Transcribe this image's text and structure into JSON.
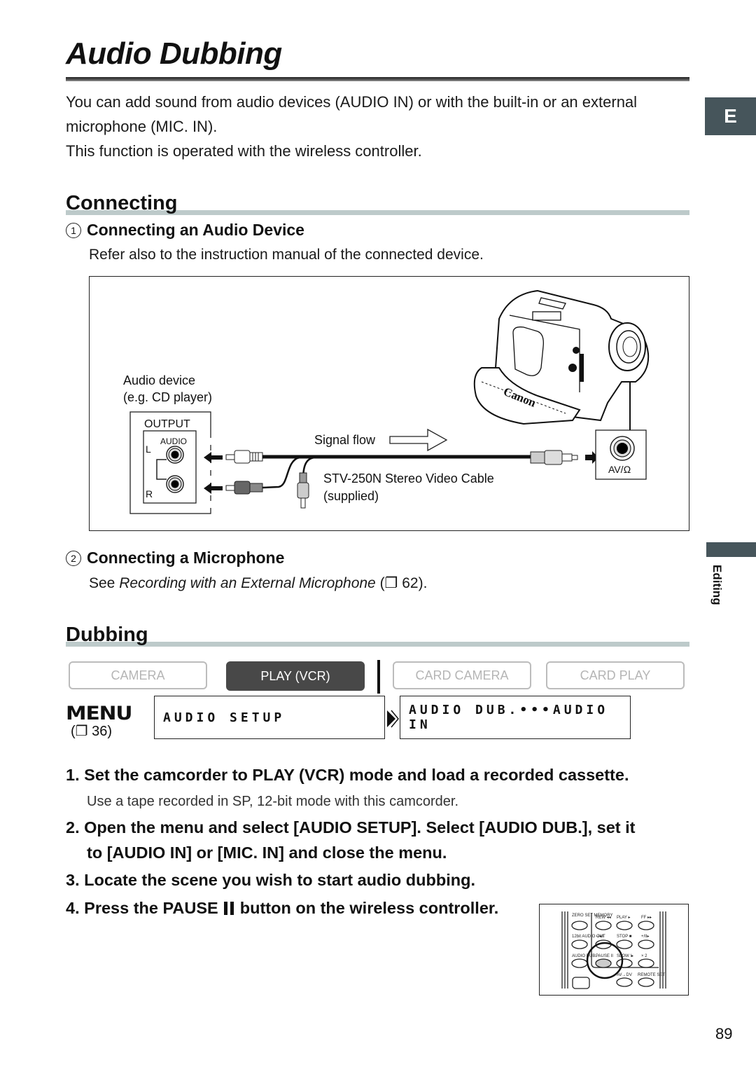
{
  "page": {
    "title": "Audio Dubbing",
    "language_tab": "E",
    "chapter_tab": "Editing",
    "page_number": "89"
  },
  "intro": {
    "line1": "You can add sound from audio devices (AUDIO IN) or with the built-in or an external",
    "line2": "microphone (MIC. IN).",
    "line3": "This function is operated with the wireless controller."
  },
  "connecting": {
    "heading": "Connecting",
    "audio_device": {
      "number": "1",
      "heading": "Connecting an Audio Device",
      "text": "Refer also to the instruction manual of the connected device."
    },
    "diagram": {
      "audio_device_label_1": "Audio device",
      "audio_device_label_2": "(e.g. CD player)",
      "output_label": "OUTPUT",
      "audio_label": "AUDIO",
      "left_label": "L",
      "right_label": "R",
      "signal_flow_label": "Signal flow",
      "cable_label_1": "STV-250N Stereo Video Cable",
      "cable_label_2": "(supplied)",
      "camcorder_jack_label": "AV/Ω",
      "brand_label": "Canon"
    },
    "microphone": {
      "number": "2",
      "heading": "Connecting a Microphone",
      "text_prefix": "See ",
      "text_ref": "Recording with an External Microphone",
      "text_suffix": " (❐ 62)."
    }
  },
  "dubbing": {
    "heading": "Dubbing",
    "modes": [
      {
        "label": "CAMERA",
        "active": false
      },
      {
        "label": "PLAY (VCR)",
        "active": true
      },
      {
        "label": "CARD CAMERA",
        "active": false
      },
      {
        "label": "CARD PLAY",
        "active": false
      }
    ],
    "menu": {
      "logo": "MENU",
      "ref": "(❐ 36)",
      "item1": "AUDIO SETUP",
      "item2": "AUDIO DUB.•••AUDIO IN"
    },
    "steps": [
      {
        "num": "1.",
        "text": "Set the camcorder to PLAY (VCR) mode and load a recorded cassette.",
        "note": "Use a tape recorded in SP, 12-bit mode with this camcorder."
      },
      {
        "num": "2.",
        "line1": "Open the menu and select [AUDIO SETUP]. Select [AUDIO DUB.], set it",
        "line2": "to [AUDIO IN] or [MIC. IN] and close the menu."
      },
      {
        "num": "3.",
        "text": "Locate the scene you wish to start audio dubbing."
      },
      {
        "num": "4.",
        "text_before": "Press the PAUSE ",
        "text_after": " button on the wireless controller."
      }
    ],
    "remote": {
      "labels": [
        "ZERO SET MEMORY",
        "REW ◂◂",
        "PLAY ▸",
        "FF ▸▸",
        "12bit AUDIO OUT",
        "−/◂II",
        "STOP ■",
        "+/II▸",
        "AUDIO DUB.",
        "PAUSE II",
        "SLOW I▸",
        "× 2",
        "AV→DV",
        "REMOTE SET"
      ]
    }
  }
}
